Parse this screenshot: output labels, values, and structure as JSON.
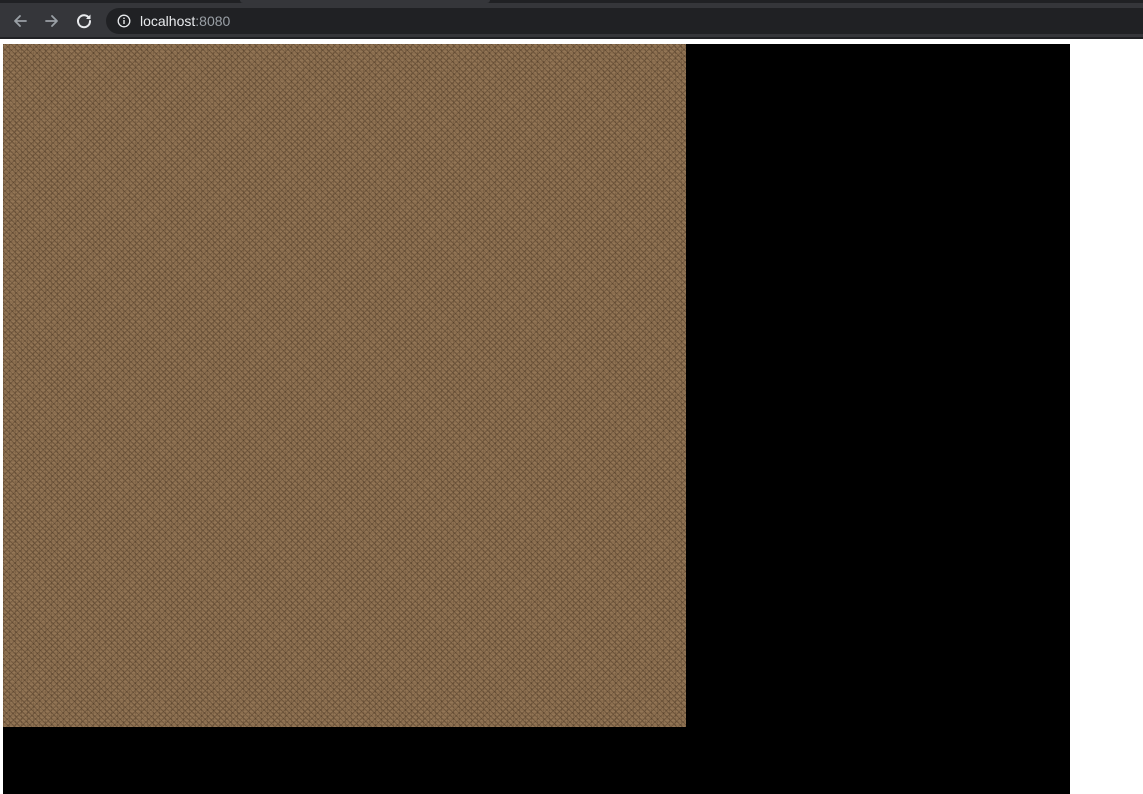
{
  "browser": {
    "url_host": "localhost",
    "url_port": ":8080"
  },
  "icons": {
    "back": "back-arrow-icon",
    "forward": "forward-arrow-icon",
    "reload": "reload-icon",
    "site_info": "info-icon"
  },
  "colors": {
    "toolbar": "#35363a",
    "omnibox": "#202124",
    "canvas_background": "#000000",
    "dirt_texture": "#8b6e4f"
  }
}
